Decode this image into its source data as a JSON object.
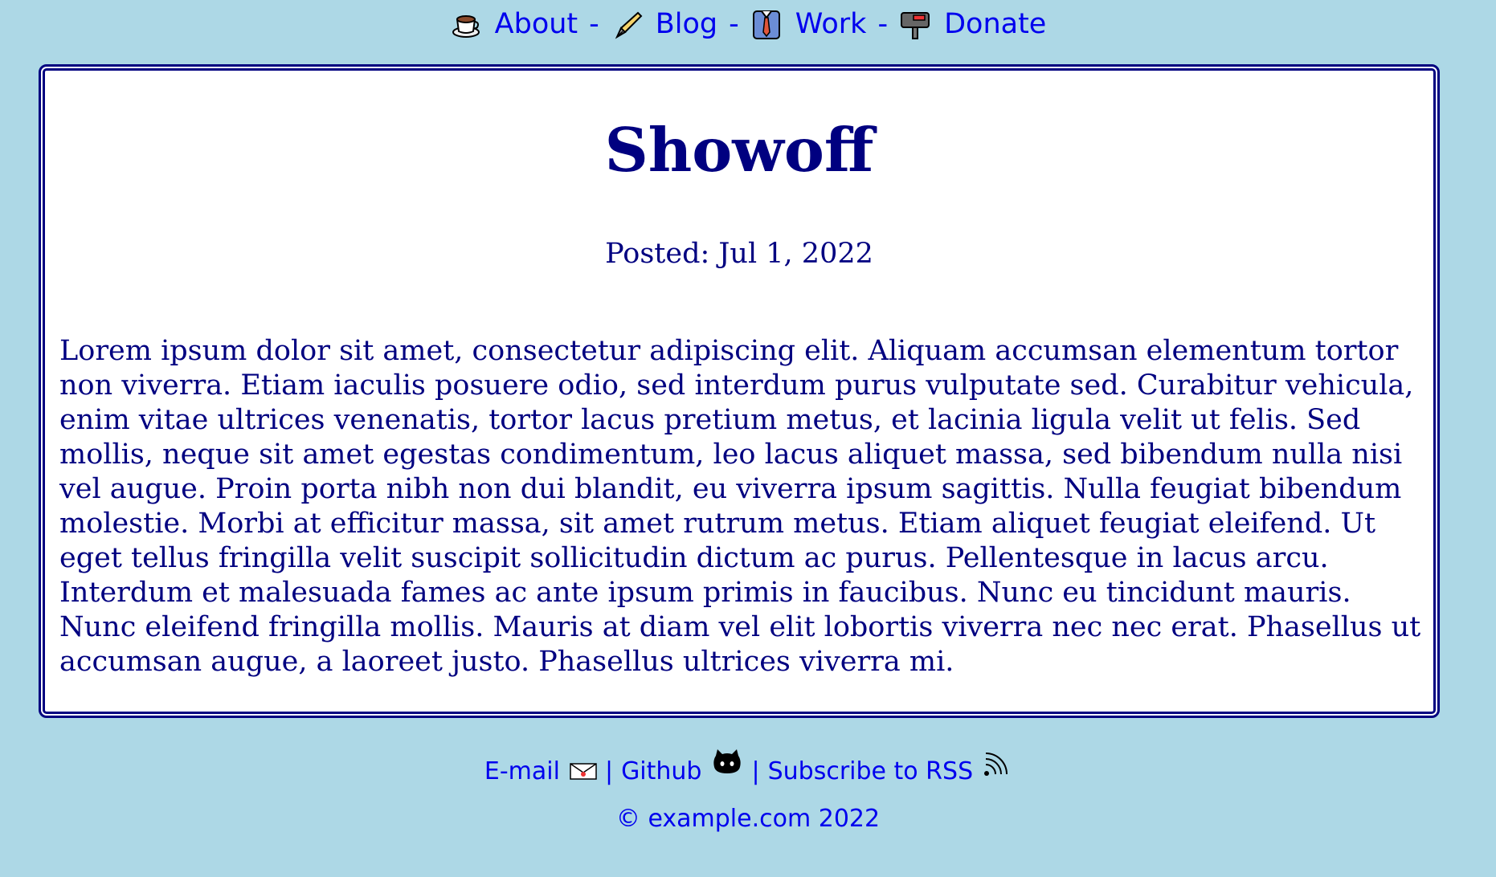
{
  "nav": {
    "items": [
      {
        "label": "About",
        "icon": "coffee-cup-icon"
      },
      {
        "label": "Blog",
        "icon": "fountain-pen-icon"
      },
      {
        "label": "Work",
        "icon": "necktie-shirt-icon"
      },
      {
        "label": "Donate",
        "icon": "mailbox-icon"
      }
    ],
    "separator": "-"
  },
  "post": {
    "title": "Showoff",
    "posted": "Posted: Jul 1, 2022",
    "body": "Lorem ipsum dolor sit amet, consectetur adipiscing elit. Aliquam accumsan elementum tortor non viverra. Etiam iaculis posuere odio, sed interdum purus vulputate sed. Curabitur vehicula, enim vitae ultrices venenatis, tortor lacus pretium metus, et lacinia ligula velit ut felis. Sed mollis, neque sit amet egestas condimentum, leo lacus aliquet massa, sed bibendum nulla nisi vel augue. Proin porta nibh non dui blandit, eu viverra ipsum sagittis. Nulla feugiat bibendum molestie. Morbi at efficitur massa, sit amet rutrum metus. Etiam aliquet feugiat eleifend. Ut eget tellus fringilla velit suscipit sollicitudin dictum ac purus. Pellentesque in lacus arcu. Interdum et malesuada fames ac ante ipsum primis in faucibus. Nunc eu tincidunt mauris. Nunc eleifend fringilla mollis. Mauris at diam vel elit lobortis viverra nec nec erat. Phasellus ut accumsan augue, a laoreet justo. Phasellus ultrices viverra mi."
  },
  "footer": {
    "email_label": "E-mail",
    "github_label": "Github",
    "rss_label": "Subscribe to RSS",
    "separator": "|",
    "copyright": "© example.com 2022"
  },
  "colors": {
    "background": "#add8e6",
    "link": "#0000ee",
    "text": "#000080",
    "card": "#ffffff"
  }
}
